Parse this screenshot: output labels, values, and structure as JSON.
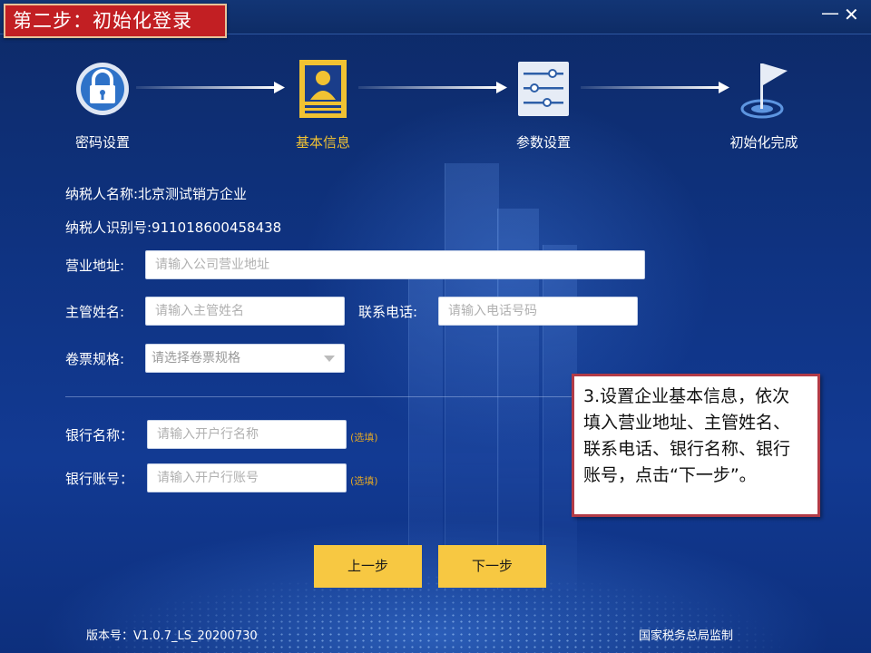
{
  "window": {
    "step_title": "第二步：初始化登录",
    "minimize": "—",
    "close": "✕"
  },
  "steps": [
    {
      "label": "密码设置",
      "icon": "lock-icon",
      "active": false
    },
    {
      "label": "基本信息",
      "icon": "id-card-icon",
      "active": true
    },
    {
      "label": "参数设置",
      "icon": "sliders-icon",
      "active": false
    },
    {
      "label": "初始化完成",
      "icon": "flag-icon",
      "active": false
    }
  ],
  "taxpayer": {
    "name_line": "纳税人名称:北京测试销方企业",
    "id_line": "纳税人识别号:911018600458438"
  },
  "form": {
    "address_label": "营业地址:",
    "address_placeholder": "请输入公司营业地址",
    "manager_label": "主管姓名:",
    "manager_placeholder": "请输入主管姓名",
    "phone_label": "联系电话:",
    "phone_placeholder": "请输入电话号码",
    "roll_label": "卷票规格:",
    "roll_placeholder": "请选择卷票规格",
    "bank_name_label": "银行名称：",
    "bank_name_placeholder": "请输入开户行名称",
    "bank_account_label": "银行账号：",
    "bank_account_placeholder": "请输入开户行账号",
    "optional_tag": "(选填)"
  },
  "buttons": {
    "prev": "上一步",
    "next": "下一步"
  },
  "callout": {
    "text": "3.设置企业基本信息，依次填入营业地址、主管姓名、联系电话、银行名称、银行账号，点击“下一步”。"
  },
  "footer": {
    "version": "版本号：V1.0.7_LS_20200730",
    "issuer": "国家税务总局监制"
  },
  "colors": {
    "accent_gold": "#f1c232",
    "title_red": "#c21f23",
    "button_yellow": "#f7c842",
    "background_blue": "#0f3382"
  }
}
